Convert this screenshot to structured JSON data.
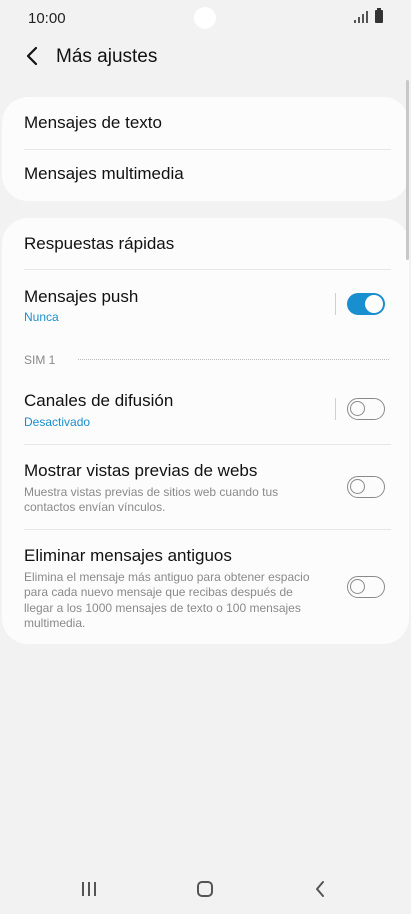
{
  "status_bar": {
    "time": "10:00"
  },
  "header": {
    "title": "Más ajustes"
  },
  "card1": {
    "items": [
      {
        "label": "Mensajes de texto"
      },
      {
        "label": "Mensajes multimedia"
      }
    ]
  },
  "card2": {
    "quick_replies": {
      "label": "Respuestas rápidas"
    },
    "push": {
      "label": "Mensajes push",
      "sub": "Nunca",
      "enabled": true
    },
    "sim_section": {
      "label": "SIM 1"
    },
    "broadcast": {
      "label": "Canales de difusión",
      "sub": "Desactivado",
      "enabled": false
    },
    "web_previews": {
      "label": "Mostrar vistas previas de webs",
      "desc": "Muestra vistas previas de sitios web cuando tus contactos envían vínculos.",
      "enabled": false
    },
    "delete_old": {
      "label": "Eliminar mensajes antiguos",
      "desc": "Elimina el mensaje más antiguo para obtener espacio para cada nuevo mensaje que recibas después de llegar a los 1000 mensajes de texto o 100 mensajes multimedia.",
      "enabled": false
    }
  },
  "colors": {
    "accent": "#1a8fcf",
    "background": "#f2f2f2",
    "card": "#fcfcfc"
  },
  "icons": [
    "back-arrow-icon",
    "signal-icon",
    "battery-icon",
    "recent-apps-icon",
    "home-icon",
    "nav-back-icon"
  ]
}
